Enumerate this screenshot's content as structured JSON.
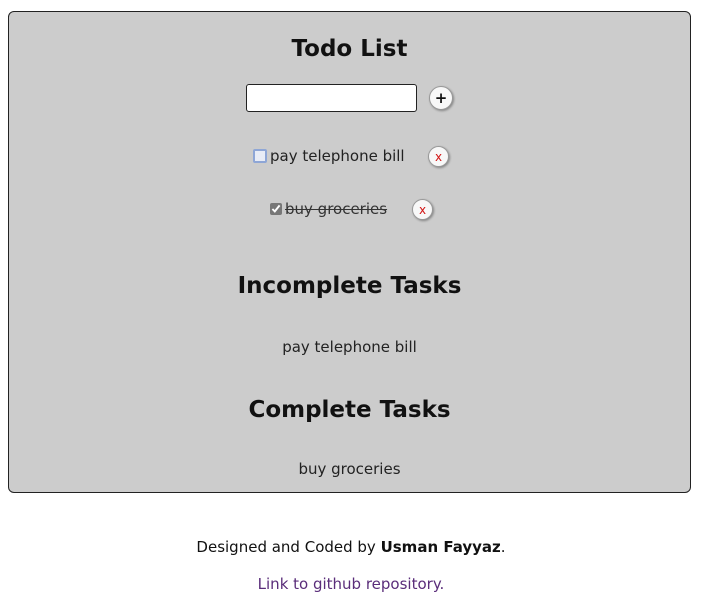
{
  "app": {
    "title": "Todo List",
    "input": {
      "value": "",
      "placeholder": ""
    },
    "add_button": "+",
    "todos": [
      {
        "text": "pay telephone bill",
        "completed": false,
        "delete_label": "x"
      },
      {
        "text": "buy groceries",
        "completed": true,
        "delete_label": "x"
      }
    ],
    "incomplete": {
      "heading": "Incomplete Tasks",
      "items": [
        "pay telephone bill"
      ]
    },
    "complete": {
      "heading": "Complete Tasks",
      "items": [
        "buy groceries"
      ]
    }
  },
  "footer": {
    "credit_prefix": "Designed and Coded by ",
    "author": "Usman Fayyaz",
    "credit_suffix": ".",
    "repo_link": "Link to github repository."
  },
  "colors": {
    "panel_bg": "#cccccc",
    "delete_x": "#d21414",
    "link": "#5a2d7a"
  }
}
